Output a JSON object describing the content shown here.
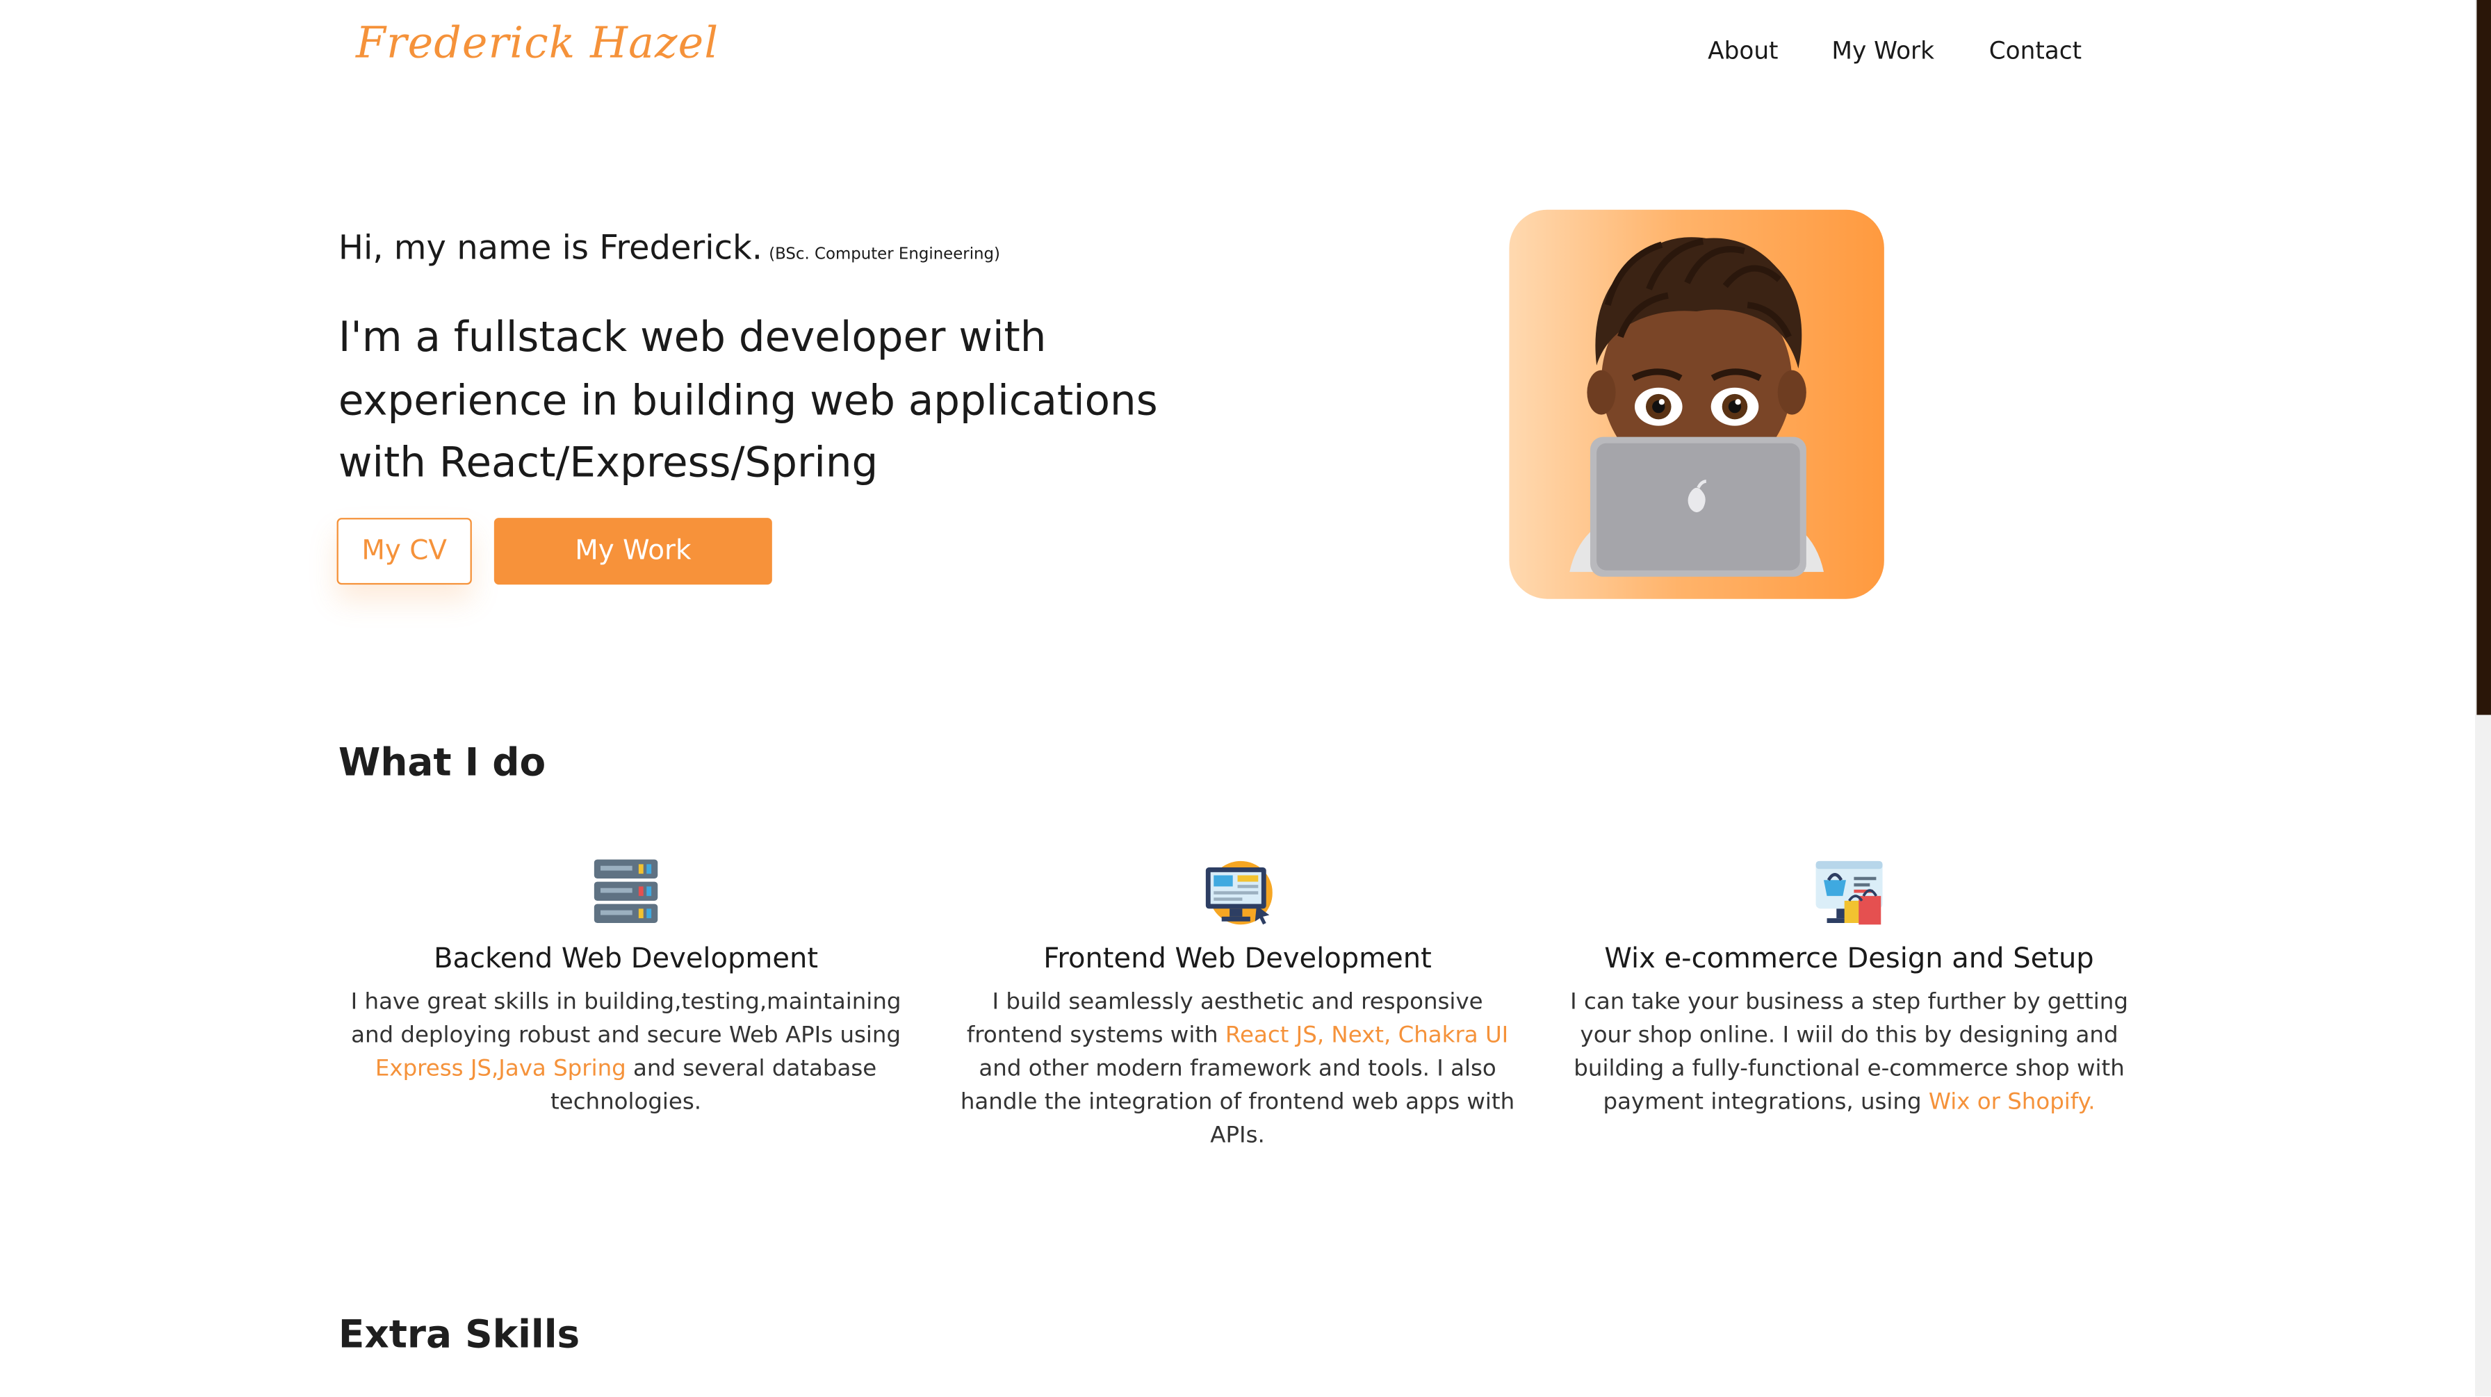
{
  "header": {
    "logo": "Frederick Hazel",
    "nav": [
      "About",
      "My Work",
      "Contact"
    ]
  },
  "hero": {
    "greeting": "Hi, my name is Frederick.",
    "degree": "(BSc. Computer Engineering)",
    "lead": "I'm a fullstack web developer with experience in building web applications with React/Express/Spring",
    "cv_button": "My CV",
    "work_button": "My Work"
  },
  "what_i_do": {
    "title": "What I do",
    "services": [
      {
        "icon": "server-icon",
        "title": "Backend Web Development",
        "desc_before": "I have great skills in building,testing,maintaining and deploying robust and secure Web APIs using ",
        "desc_highlight": "Express JS,Java Spring",
        "desc_after": " and several database technologies."
      },
      {
        "icon": "monitor-design-icon",
        "title": "Frontend Web Development",
        "desc_before": "I build seamlessly aesthetic and responsive frontend systems with ",
        "desc_highlight": "React JS, Next, Chakra UI",
        "desc_after": " and other modern framework and tools. I also handle the integration of frontend web apps with APIs."
      },
      {
        "icon": "ecommerce-icon",
        "title": "Wix e-commerce Design and Setup",
        "desc_before": "I can take your business a step further by getting your shop online. I wiil do this by designing and building a fully-functional e-commerce shop with payment integrations, using ",
        "desc_highlight": "Wix or Shopify.",
        "desc_after": ""
      }
    ]
  },
  "extra_skills": {
    "title": "Extra Skills"
  },
  "colors": {
    "accent": "#f5923a",
    "text": "#1a1a1a",
    "scrollbar_thumb": "#2a1608"
  }
}
